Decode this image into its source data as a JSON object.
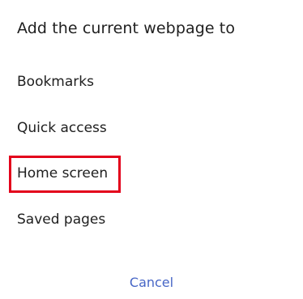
{
  "dialog": {
    "title": "Add the current webpage to",
    "options": [
      {
        "label": "Bookmarks"
      },
      {
        "label": "Quick access"
      },
      {
        "label": "Home screen",
        "highlighted": true
      },
      {
        "label": "Saved pages"
      }
    ],
    "cancel_label": "Cancel"
  },
  "colors": {
    "text": "#202020",
    "accent": "#4766c6",
    "highlight": "#e3001b",
    "background": "#ffffff"
  }
}
